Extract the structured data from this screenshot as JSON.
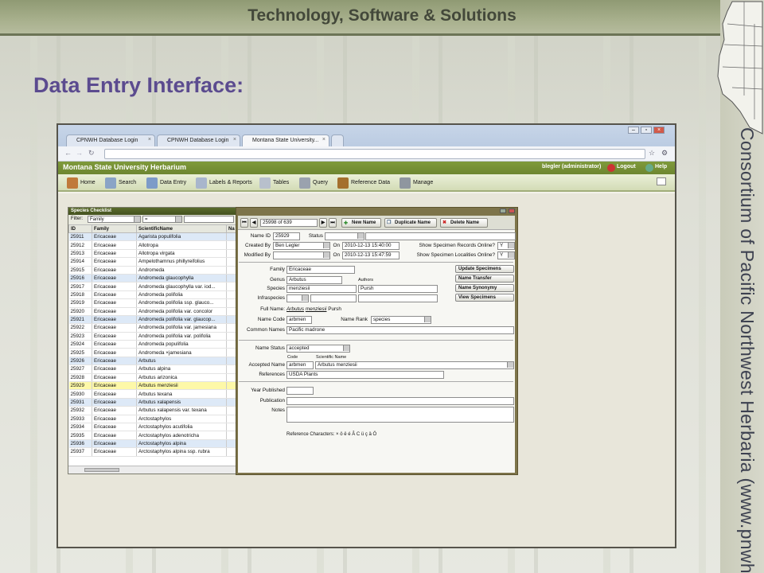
{
  "slide": {
    "title": "Technology, Software & Solutions",
    "heading": "Data Entry Interface:",
    "side_text": "Consortium of Pacific Northwest Herbaria (www.pnwherbaria.org)"
  },
  "browser": {
    "tabs": [
      {
        "label": "CPNWH Database Login"
      },
      {
        "label": "CPNWH Database Login"
      },
      {
        "label": "Montana State University..."
      }
    ],
    "active_tab": 2
  },
  "app": {
    "title": "Montana State University Herbarium",
    "user": "blegler (administrator)",
    "logout": "Logout",
    "help": "Help",
    "toolbar": [
      {
        "label": "Home",
        "icon": "home-icon"
      },
      {
        "label": "Search",
        "icon": "search-icon"
      },
      {
        "label": "Data Entry",
        "icon": "data-entry-icon"
      },
      {
        "label": "Labels & Reports",
        "icon": "labels-icon"
      },
      {
        "label": "Tables",
        "icon": "tables-icon"
      },
      {
        "label": "Query",
        "icon": "query-icon"
      },
      {
        "label": "Reference Data",
        "icon": "book-icon"
      },
      {
        "label": "Manage",
        "icon": "wrench-icon"
      }
    ]
  },
  "checklist": {
    "title": "Species Checklist",
    "filter_label": "Filter:",
    "filter_field": "Family",
    "filter_op": "=",
    "columns": [
      "ID",
      "Family",
      "ScientificName",
      "Na"
    ],
    "rows": [
      [
        "25911",
        "Ericaceae",
        "Agarista populifolia"
      ],
      [
        "25912",
        "Ericaceae",
        "Allotropa"
      ],
      [
        "25913",
        "Ericaceae",
        "Allotropa virgata"
      ],
      [
        "25914",
        "Ericaceae",
        "Ampelothamnus phillyreifolius"
      ],
      [
        "25915",
        "Ericaceae",
        "Andromeda"
      ],
      [
        "25916",
        "Ericaceae",
        "Andromeda glaucophylla"
      ],
      [
        "25917",
        "Ericaceae",
        "Andromeda glaucophylla var. iod..."
      ],
      [
        "25918",
        "Ericaceae",
        "Andromeda polifolia"
      ],
      [
        "25919",
        "Ericaceae",
        "Andromeda polifolia ssp. glauco..."
      ],
      [
        "25920",
        "Ericaceae",
        "Andromeda polifolia var. concolor"
      ],
      [
        "25921",
        "Ericaceae",
        "Andromeda polifolia var. glaucop..."
      ],
      [
        "25922",
        "Ericaceae",
        "Andromeda polifolia var. jamesiana"
      ],
      [
        "25923",
        "Ericaceae",
        "Andromeda polifolia var. polifolia"
      ],
      [
        "25924",
        "Ericaceae",
        "Andromeda populifolia"
      ],
      [
        "25925",
        "Ericaceae",
        "Andromeda ×jamesiana"
      ],
      [
        "25926",
        "Ericaceae",
        "Arbutus"
      ],
      [
        "25927",
        "Ericaceae",
        "Arbutus alpina"
      ],
      [
        "25928",
        "Ericaceae",
        "Arbutus arizonica"
      ],
      [
        "25929",
        "Ericaceae",
        "Arbutus menziesii"
      ],
      [
        "25930",
        "Ericaceae",
        "Arbutus texana"
      ],
      [
        "25931",
        "Ericaceae",
        "Arbutus xalapensis"
      ],
      [
        "25932",
        "Ericaceae",
        "Arbutus xalapensis var. texana"
      ],
      [
        "25933",
        "Ericaceae",
        "Arctostaphylos"
      ],
      [
        "25934",
        "Ericaceae",
        "Arctostaphylos acutifolia"
      ],
      [
        "25935",
        "Ericaceae",
        "Arctostaphylos adenotricha"
      ],
      [
        "25936",
        "Ericaceae",
        "Arctostaphylos alpina"
      ],
      [
        "25937",
        "Ericaceae",
        "Arctostaphylos alpina ssp. rubra"
      ]
    ],
    "selected_id": "25929"
  },
  "detail": {
    "record_counter": "25998 of 639",
    "new_name": "New Name",
    "duplicate_name": "Duplicate Name",
    "delete_name": "Delete Name",
    "name_id_label": "Name ID",
    "name_id": "25929",
    "status_label": "Status",
    "created_by_label": "Created By",
    "created_by": "Ben Legler",
    "on_label": "On",
    "created_on": "2010-12-13 15:40:00",
    "modified_by_label": "Modified By",
    "modified_on": "2010-12-13 15:47:59",
    "show_records_label": "Show Specimen Records Online?",
    "show_records": "Y",
    "show_localities_label": "Show Specimen Localities Online?",
    "show_localities": "Y",
    "family_label": "Family",
    "family": "Ericaceae",
    "genus_label": "Genus",
    "genus": "Arbutus",
    "authors_label": "Authors",
    "species_label": "Species",
    "species": "menziesii",
    "species_author": "Pursh",
    "infraspecies_label": "Infraspecies",
    "fullname_label": "Full Name:",
    "fullname_genus": "Arbutus",
    "fullname_species": "menziesii",
    "fullname_author": "Pursh",
    "name_code_label": "Name Code",
    "name_code": "arbmen",
    "name_rank_label": "Name Rank",
    "name_rank": "species",
    "common_names_label": "Common Names",
    "common_names": "Pacific madrone",
    "side_buttons": [
      "Update Specimens",
      "Name Transfer",
      "Name Synonymy",
      "View Specimens"
    ],
    "name_status_label": "Name Status",
    "name_status": "accepted",
    "code_small": "Code",
    "sciname_small": "Scientific Name",
    "accepted_name_label": "Accepted Name",
    "accepted_code": "arbmen",
    "accepted_name": "Arbutus menziesii",
    "references_label": "References",
    "references": "USDA Plants",
    "year_published_label": "Year Published",
    "publication_label": "Publication",
    "notes_label": "Notes",
    "reference_chars": "Reference Characters: × ö ë é Â C ü ç ä Ö"
  }
}
